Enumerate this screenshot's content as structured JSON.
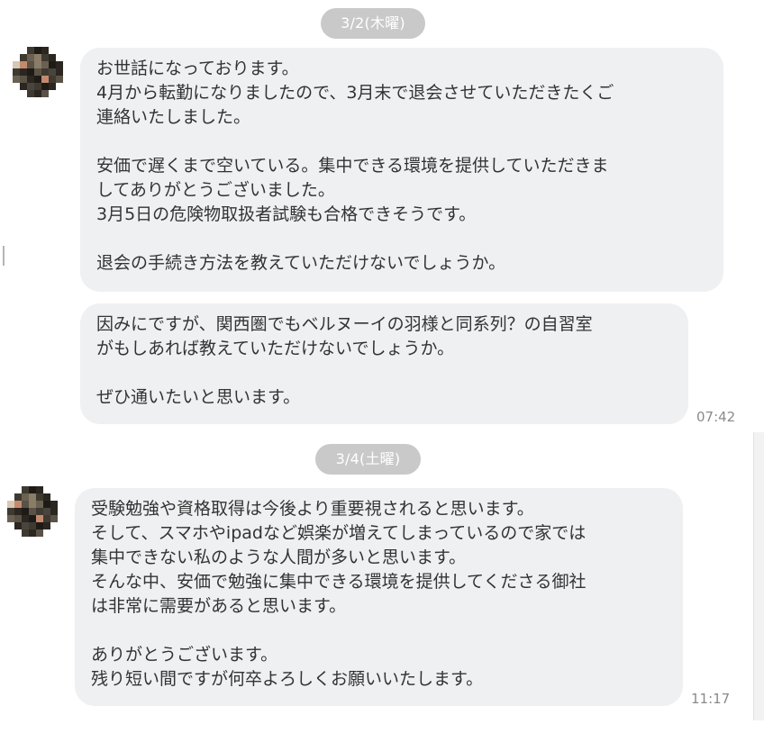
{
  "dates": {
    "first": "3/2(木曜)",
    "second": "3/4(土曜)"
  },
  "messages": {
    "m1": {
      "lines": [
        "お世話になっております。",
        "4月から転勤になりましたので、3月末で退会させていただきたくご",
        "連絡いたしました。",
        "",
        "安価で遅くまで空いている。集中できる環境を提供していただきま",
        "してありがとうございました。",
        "3月5日の危険物取扱者試験も合格できそうです。",
        "",
        "退会の手続き方法を教えていただけないでしょうか。"
      ]
    },
    "m2": {
      "lines": [
        "因みにですが、関西圏でもベルヌーイの羽様と同系列？の自習室",
        "がもしあれば教えていただけないでしょうか。",
        "",
        "ぜひ通いたいと思います。"
      ],
      "time": "07:42"
    },
    "m3": {
      "lines": [
        "受験勉強や資格取得は今後より重要視されると思います。",
        "そして、スマホやipadなど娯楽が増えてしまっているので家では",
        "集中できない私のような人間が多いと思います。",
        "そんな中、安価で勉強に集中できる環境を提供してくださる御社",
        "は非常に需要があると思います。",
        "",
        "ありがとうございます。",
        "残り短い間ですが何卒よろしくお願いいたします。"
      ],
      "time": "11:17"
    }
  },
  "colors": {
    "bubble": "#eff0f2",
    "date_pill": "#c9c9c9",
    "text": "#333333",
    "timestamp": "#8a8a8a"
  }
}
